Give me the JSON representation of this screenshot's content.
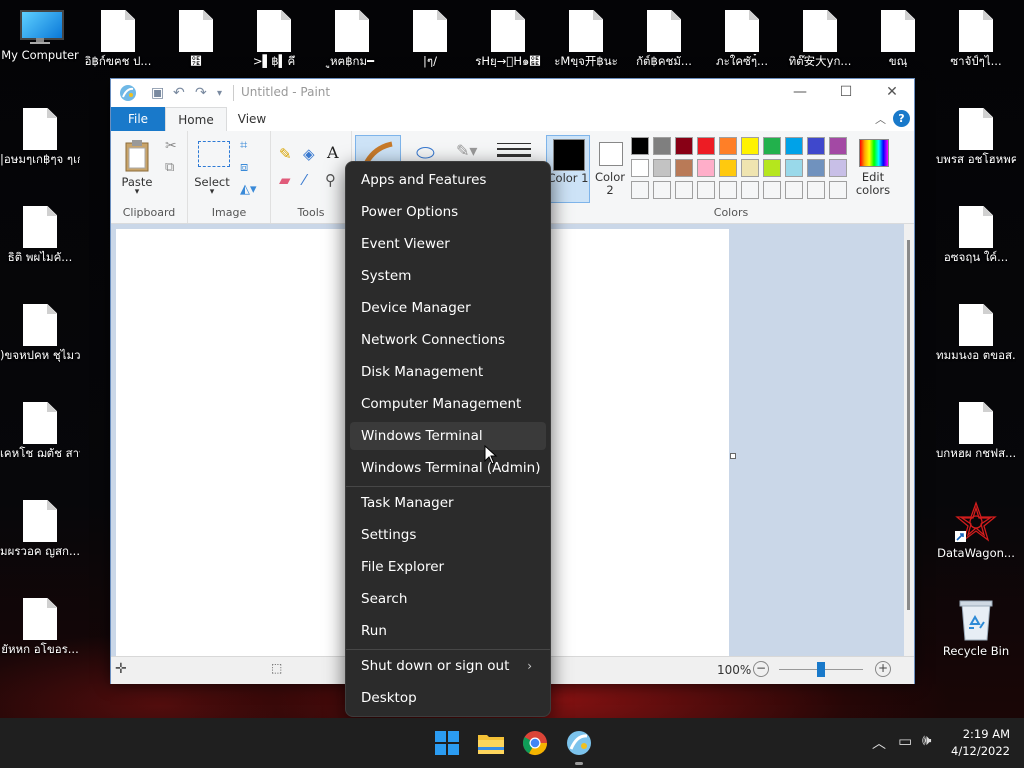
{
  "desktop": {
    "icons": [
      {
        "label": "My Computer",
        "kind": "computer"
      },
      {
        "label": "อิ฿ก์ฃฅช ป...",
        "kind": "doc"
      },
      {
        "label": "๾",
        "kind": "doc"
      },
      {
        "label": ">▌฿▍คึ",
        "kind": "doc"
      },
      {
        "label": "ูหฅ฿กม━",
        "kind": "doc"
      },
      {
        "label": "|ๆ/",
        "kind": "doc"
      },
      {
        "label": "รHยฺ→ัH๑๞",
        "kind": "doc"
      },
      {
        "label": "ะMขฺจ开฿นะ",
        "kind": "doc"
      },
      {
        "label": "กัต์฿คชมั...",
        "kind": "doc"
      },
      {
        "label": "ภะใคซัๆ๋...",
        "kind": "doc"
      },
      {
        "label": "ทิต๊安大yก...",
        "kind": "doc"
      },
      {
        "label": "ขณฺ",
        "kind": "doc"
      },
      {
        "label": "ซาจัป์ๆไ...",
        "kind": "doc"
      }
    ],
    "left_column": [
      "|อษมๆเก฿ๆจ ๆเก฿ๆจ",
      "ธิติ พผไมคั...",
      ")ขจหปคห ชุไมวส...",
      "เคหโช ฌตัช สาบ฿...",
      "มผรวอค ญสก...",
      "ยัหหก อโขอร..."
    ],
    "right_column": [
      "บพรส อชโฮหพค...",
      "อซจฤน ใค์...",
      "ทมมนงอ ตขอส...",
      "บกหฮผ กชฟส..."
    ],
    "shortcut_datawagon": "DataWagon...",
    "recycle_bin": "Recycle Bin"
  },
  "paint": {
    "title": "Untitled - Paint",
    "tabs": {
      "file": "File",
      "home": "Home",
      "view": "View"
    },
    "groups": {
      "clipboard": "Clipboard",
      "image": "Image",
      "tools": "Tools",
      "colors": "Colors"
    },
    "buttons": {
      "paste": "Paste",
      "select": "Select",
      "color1": "Color 1",
      "color2": "Color 2",
      "edit_colors": "Edit colors"
    },
    "palette_row1": [
      "#000000",
      "#7f7f7f",
      "#880015",
      "#ed1c24",
      "#ff7f27",
      "#fff200",
      "#22b14c",
      "#00a2e8",
      "#3f48cc",
      "#a349a4"
    ],
    "palette_row2": [
      "#ffffff",
      "#c3c3c3",
      "#b97a57",
      "#ffaec9",
      "#ffc90e",
      "#efe4b0",
      "#b5e61d",
      "#99d9ea",
      "#7092be",
      "#c8bfe7"
    ],
    "zoom": "100%",
    "accent": "#1979ca"
  },
  "context_menu": {
    "group1": [
      "Apps and Features",
      "Power Options",
      "Event Viewer",
      "System",
      "Device Manager",
      "Network Connections",
      "Disk Management",
      "Computer Management",
      "Windows Terminal",
      "Windows Terminal (Admin)"
    ],
    "group2": [
      "Task Manager",
      "Settings",
      "File Explorer",
      "Search",
      "Run"
    ],
    "group3": [
      "Shut down or sign out",
      "Desktop"
    ],
    "highlighted": "Windows Terminal"
  },
  "taskbar": {
    "time": "2:19 AM",
    "date": "4/12/2022",
    "apps": [
      "start-icon",
      "file-explorer-icon",
      "chrome-icon",
      "paint-icon"
    ]
  }
}
